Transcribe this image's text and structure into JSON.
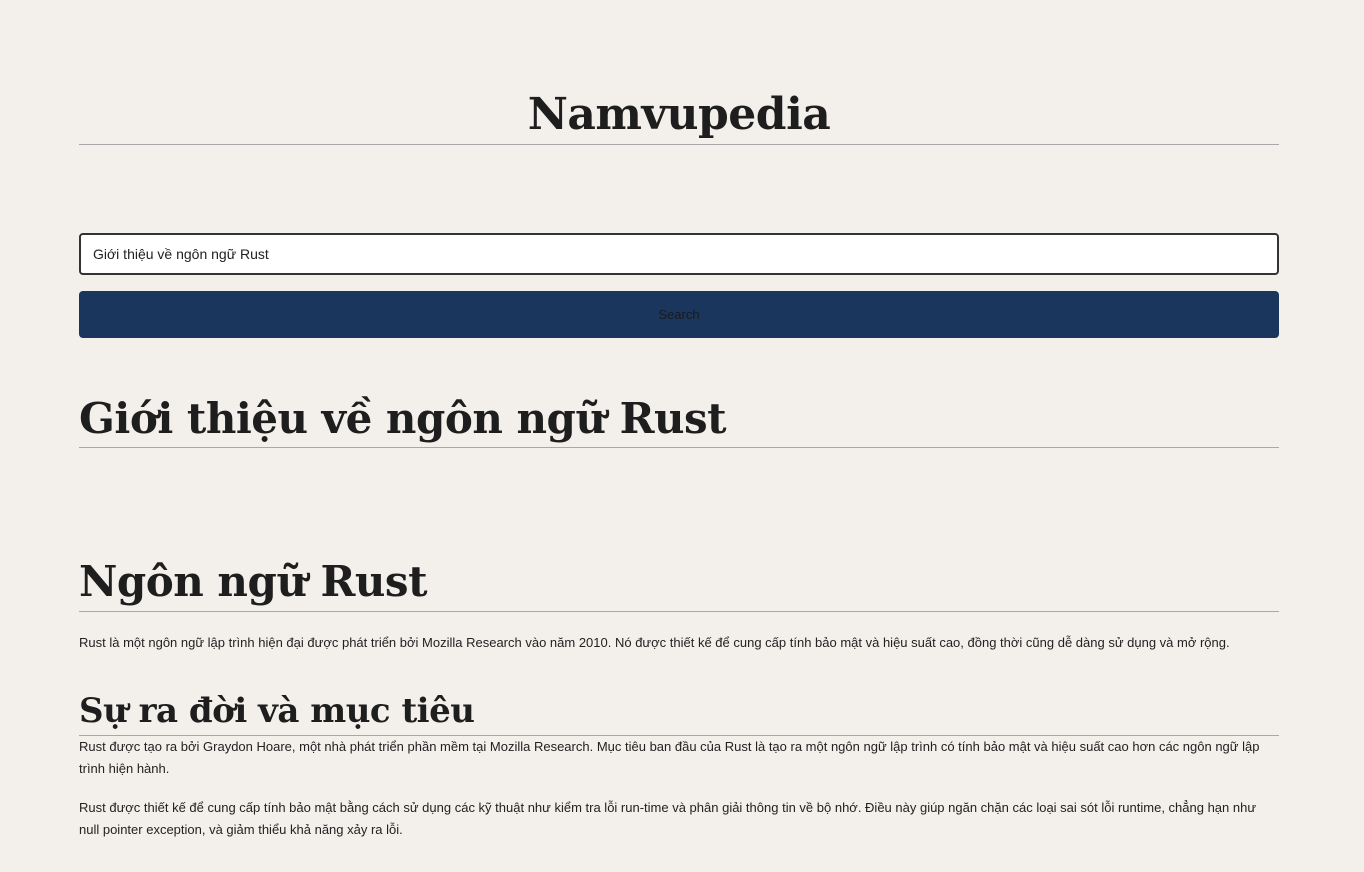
{
  "site": {
    "title": "Namvupedia"
  },
  "search": {
    "value": "Giới thiệu về ngôn ngữ Rust",
    "button_label": "Search"
  },
  "article": {
    "title": "Giới thiệu về ngôn ngữ Rust",
    "sections": [
      {
        "heading": "Ngôn ngữ Rust",
        "paragraphs": [
          "Rust là một ngôn ngữ lập trình hiện đại được phát triển bởi Mozilla Research vào năm 2010. Nó được thiết kế để cung cấp tính bảo mật và hiệu suất cao, đồng thời cũng dễ dàng sử dụng và mở rộng."
        ]
      },
      {
        "heading": "Sự ra đời và mục tiêu",
        "paragraphs": [
          "Rust được tạo ra bởi Graydon Hoare, một nhà phát triển phần mềm tại Mozilla Research. Mục tiêu ban đầu của Rust là tạo ra một ngôn ngữ lập trình có tính bảo mật và hiệu suất cao hơn các ngôn ngữ lập trình hiện hành.",
          "Rust được thiết kế để cung cấp tính bảo mật bằng cách sử dụng các kỹ thuật như kiểm tra lỗi run-time và phân giải thông tin về bộ nhớ. Điều này giúp ngăn chặn các loại sai sót lỗi runtime, chẳng hạn như null pointer exception, và giảm thiểu khả năng xảy ra lỗi."
        ]
      }
    ]
  },
  "colors": {
    "background": "#f3efeb",
    "button": "#1b365d",
    "rule": "#a8a8a8"
  }
}
